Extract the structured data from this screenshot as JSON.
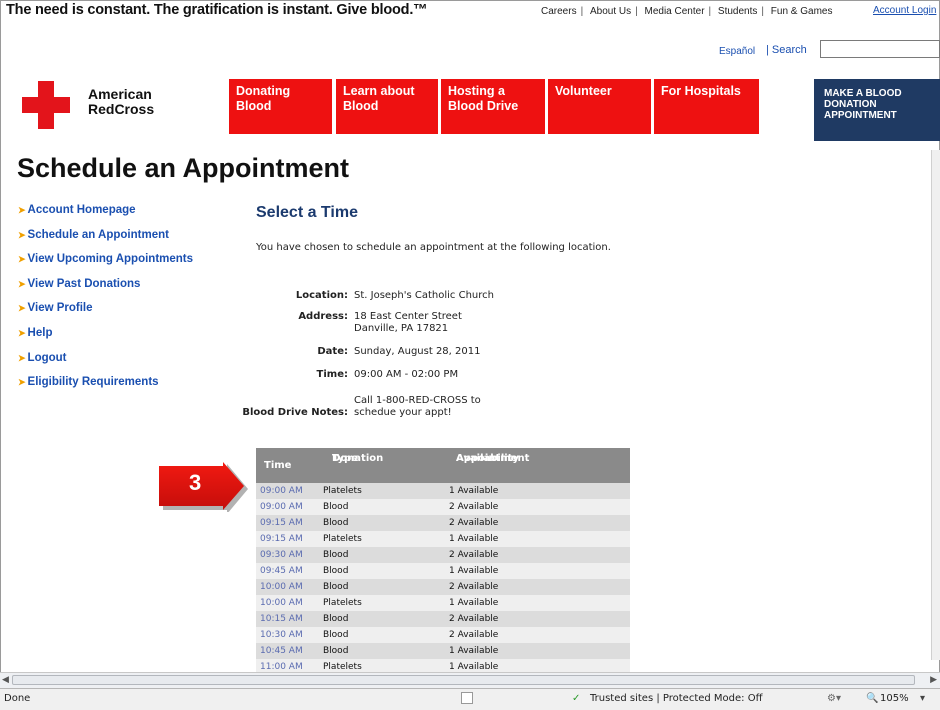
{
  "header": {
    "tagline": "The need is constant. The gratification is instant. Give blood.™",
    "top_links": [
      "Careers",
      "About Us",
      "Media Center",
      "Students",
      "Fun & Games"
    ],
    "account_login": "Account Login",
    "espanol": "Español",
    "search_label": "| Search",
    "search_value": ""
  },
  "logo": {
    "line1": "American",
    "line2": "RedCross"
  },
  "nav": [
    {
      "line1": "Donating",
      "line2": "Blood"
    },
    {
      "line1": "Learn about",
      "line2": "Blood"
    },
    {
      "line1": "Hosting a",
      "line2": "Blood Drive"
    },
    {
      "line1": "Volunteer",
      "line2": ""
    },
    {
      "line1": "For Hospitals",
      "line2": ""
    }
  ],
  "cta": {
    "line1": "MAKE A BLOOD",
    "line2": "DONATION",
    "line3": "APPOINTMENT"
  },
  "page_title": "Schedule an Appointment",
  "sidebar": [
    "Account Homepage",
    "Schedule an Appointment",
    "View Upcoming Appointments",
    "View Past Donations",
    "View Profile",
    "Help",
    "Logout",
    "Eligibility Requirements"
  ],
  "main": {
    "section_title": "Select a Time",
    "intro": "You have chosen to schedule an appointment at the following location.",
    "location_label": "Location:",
    "location": "St. Joseph's Catholic Church",
    "address_label": "Address:",
    "address_line1": "18 East Center Street",
    "address_line2": "Danville, PA 17821",
    "date_label": "Date:",
    "date": "Sunday, August 28, 2011",
    "time_label": "Time:",
    "time": "09:00 AM - 02:00 PM",
    "notes_label": "Blood Drive Notes:",
    "notes_line1": "Call 1-800-RED-CROSS to",
    "notes_line2": "schedue your appt!"
  },
  "table": {
    "headers": {
      "time": "Time",
      "type_1": "Donation",
      "type_2": "Type",
      "avail_1": "Appointment",
      "avail_2": "Availability"
    },
    "rows": [
      {
        "time": "09:00 AM",
        "type": "Platelets",
        "avail": "1 Available"
      },
      {
        "time": "09:00 AM",
        "type": "Blood",
        "avail": "2 Available"
      },
      {
        "time": "09:15 AM",
        "type": "Blood",
        "avail": "2 Available"
      },
      {
        "time": "09:15 AM",
        "type": "Platelets",
        "avail": "1 Available"
      },
      {
        "time": "09:30 AM",
        "type": "Blood",
        "avail": "2 Available"
      },
      {
        "time": "09:45 AM",
        "type": "Blood",
        "avail": "1 Available"
      },
      {
        "time": "10:00 AM",
        "type": "Blood",
        "avail": "2 Available"
      },
      {
        "time": "10:00 AM",
        "type": "Platelets",
        "avail": "1 Available"
      },
      {
        "time": "10:15 AM",
        "type": "Blood",
        "avail": "2 Available"
      },
      {
        "time": "10:30 AM",
        "type": "Blood",
        "avail": "2 Available"
      },
      {
        "time": "10:45 AM",
        "type": "Blood",
        "avail": "1 Available"
      },
      {
        "time": "11:00 AM",
        "type": "Platelets",
        "avail": "1 Available"
      }
    ]
  },
  "callout": {
    "step": "3"
  },
  "statusbar": {
    "status": "Done",
    "zone": "Trusted sites | Protected Mode: Off",
    "zoom": "105%"
  },
  "colors": {
    "nav_red": "#ee1111",
    "cta_navy": "#1f3a63",
    "link_blue": "#1a4fb0",
    "header_gray": "#8a8a8a"
  }
}
